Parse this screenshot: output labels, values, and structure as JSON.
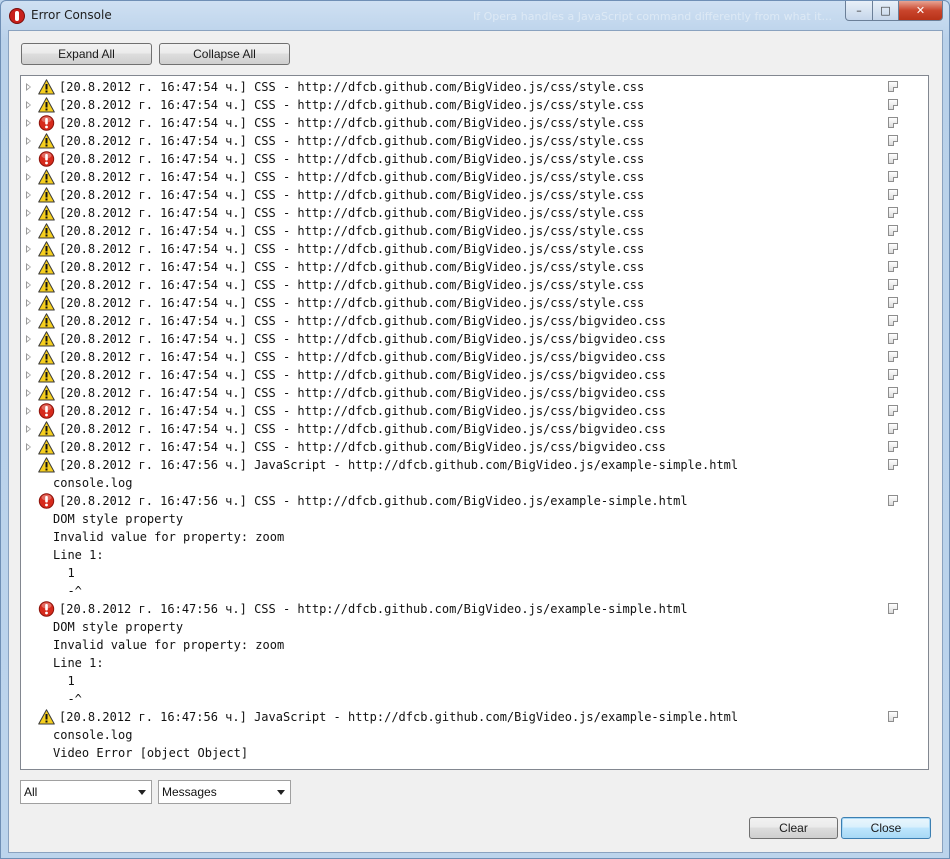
{
  "window": {
    "title": "Error Console",
    "ghost_title": "If Opera handles a JavaScript command differently from what it..."
  },
  "toolbar": {
    "expand_all": "Expand All",
    "collapse_all": "Collapse All"
  },
  "entries": [
    {
      "severity": "warning",
      "text": "[20.8.2012 г. 16:47:54 ч.] CSS - http://dfcb.github.com/BigVideo.js/css/style.css",
      "details": []
    },
    {
      "severity": "warning",
      "text": "[20.8.2012 г. 16:47:54 ч.] CSS - http://dfcb.github.com/BigVideo.js/css/style.css",
      "details": []
    },
    {
      "severity": "error",
      "text": "[20.8.2012 г. 16:47:54 ч.] CSS - http://dfcb.github.com/BigVideo.js/css/style.css",
      "details": []
    },
    {
      "severity": "warning",
      "text": "[20.8.2012 г. 16:47:54 ч.] CSS - http://dfcb.github.com/BigVideo.js/css/style.css",
      "details": []
    },
    {
      "severity": "error",
      "text": "[20.8.2012 г. 16:47:54 ч.] CSS - http://dfcb.github.com/BigVideo.js/css/style.css",
      "details": []
    },
    {
      "severity": "warning",
      "text": "[20.8.2012 г. 16:47:54 ч.] CSS - http://dfcb.github.com/BigVideo.js/css/style.css",
      "details": []
    },
    {
      "severity": "warning",
      "text": "[20.8.2012 г. 16:47:54 ч.] CSS - http://dfcb.github.com/BigVideo.js/css/style.css",
      "details": []
    },
    {
      "severity": "warning",
      "text": "[20.8.2012 г. 16:47:54 ч.] CSS - http://dfcb.github.com/BigVideo.js/css/style.css",
      "details": []
    },
    {
      "severity": "warning",
      "text": "[20.8.2012 г. 16:47:54 ч.] CSS - http://dfcb.github.com/BigVideo.js/css/style.css",
      "details": []
    },
    {
      "severity": "warning",
      "text": "[20.8.2012 г. 16:47:54 ч.] CSS - http://dfcb.github.com/BigVideo.js/css/style.css",
      "details": []
    },
    {
      "severity": "warning",
      "text": "[20.8.2012 г. 16:47:54 ч.] CSS - http://dfcb.github.com/BigVideo.js/css/style.css",
      "details": []
    },
    {
      "severity": "warning",
      "text": "[20.8.2012 г. 16:47:54 ч.] CSS - http://dfcb.github.com/BigVideo.js/css/style.css",
      "details": []
    },
    {
      "severity": "warning",
      "text": "[20.8.2012 г. 16:47:54 ч.] CSS - http://dfcb.github.com/BigVideo.js/css/style.css",
      "details": []
    },
    {
      "severity": "warning",
      "text": "[20.8.2012 г. 16:47:54 ч.] CSS - http://dfcb.github.com/BigVideo.js/css/bigvideo.css",
      "details": []
    },
    {
      "severity": "warning",
      "text": "[20.8.2012 г. 16:47:54 ч.] CSS - http://dfcb.github.com/BigVideo.js/css/bigvideo.css",
      "details": []
    },
    {
      "severity": "warning",
      "text": "[20.8.2012 г. 16:47:54 ч.] CSS - http://dfcb.github.com/BigVideo.js/css/bigvideo.css",
      "details": []
    },
    {
      "severity": "warning",
      "text": "[20.8.2012 г. 16:47:54 ч.] CSS - http://dfcb.github.com/BigVideo.js/css/bigvideo.css",
      "details": []
    },
    {
      "severity": "warning",
      "text": "[20.8.2012 г. 16:47:54 ч.] CSS - http://dfcb.github.com/BigVideo.js/css/bigvideo.css",
      "details": []
    },
    {
      "severity": "error",
      "text": "[20.8.2012 г. 16:47:54 ч.] CSS - http://dfcb.github.com/BigVideo.js/css/bigvideo.css",
      "details": []
    },
    {
      "severity": "warning",
      "text": "[20.8.2012 г. 16:47:54 ч.] CSS - http://dfcb.github.com/BigVideo.js/css/bigvideo.css",
      "details": []
    },
    {
      "severity": "warning",
      "text": "[20.8.2012 г. 16:47:54 ч.] CSS - http://dfcb.github.com/BigVideo.js/css/bigvideo.css",
      "details": []
    },
    {
      "severity": "warning",
      "text": "[20.8.2012 г. 16:47:56 ч.] JavaScript - http://dfcb.github.com/BigVideo.js/example-simple.html",
      "details": [
        "console.log"
      ]
    },
    {
      "severity": "error",
      "text": "[20.8.2012 г. 16:47:56 ч.] CSS - http://dfcb.github.com/BigVideo.js/example-simple.html",
      "details": [
        "DOM style property",
        "Invalid value for property: zoom",
        "Line 1:",
        "  1",
        "  -^"
      ]
    },
    {
      "severity": "error",
      "text": "[20.8.2012 г. 16:47:56 ч.] CSS - http://dfcb.github.com/BigVideo.js/example-simple.html",
      "details": [
        "DOM style property",
        "Invalid value for property: zoom",
        "Line 1:",
        "  1",
        "  -^"
      ]
    },
    {
      "severity": "warning",
      "text": "[20.8.2012 г. 16:47:56 ч.] JavaScript - http://dfcb.github.com/BigVideo.js/example-simple.html",
      "details": [
        "console.log",
        "Video Error [object Object]"
      ]
    }
  ],
  "filters": {
    "source_value": "All",
    "type_value": "Messages"
  },
  "footer": {
    "clear": "Clear",
    "close": "Close"
  },
  "icons": {
    "warning": "warning-icon",
    "error": "error-icon",
    "note": "note-icon",
    "expander": "expand-arrow-icon"
  },
  "colors": {
    "error": "#d62a1c",
    "warning": "#f6cf1e"
  }
}
